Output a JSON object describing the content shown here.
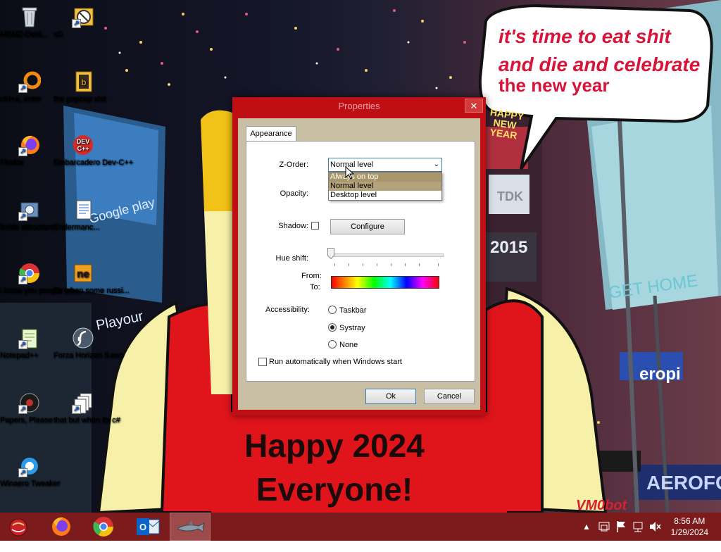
{
  "wallpaper": {
    "bubble_lines": [
      "it's time to eat shit",
      "and die and celebrate",
      "the new year"
    ],
    "poster_lines": [
      "Happy 2024",
      "Everyone!"
    ],
    "billboard_texts": [
      "Google play",
      "TDK",
      "GET HOME",
      "eropi",
      "AEROFOS",
      "VM0bot",
      "HAPPY NEW YEAR",
      "2015",
      "Playour"
    ]
  },
  "desktop_icons": [
    {
      "label": "MEMZ-Dest...",
      "icon": "recycle-bin-icon"
    },
    {
      "label": "xD",
      "icon": "blocked-image-icon"
    },
    {
      "label": "ctrl+a, enter",
      "icon": "orange-ring-icon"
    },
    {
      "label": "the popcap shit",
      "icon": "popcap-folder-icon"
    },
    {
      "label": "Firefox",
      "icon": "firefox-icon"
    },
    {
      "label": "Embarcadero Dev-C++",
      "icon": "devcpp-icon"
    },
    {
      "label": "forkie attractant",
      "icon": "settings-app-icon"
    },
    {
      "label": "Endermanc...",
      "icon": "document-icon"
    },
    {
      "label": "i know you people we...",
      "icon": "chrome-icon"
    },
    {
      "label": "for when some russi...",
      "icon": "dotnet-icon"
    },
    {
      "label": "Notepad++",
      "icon": "notepadpp-icon"
    },
    {
      "label": "Forza Horizon 5.exe",
      "icon": "flash-icon"
    },
    {
      "label": "Papers, Please",
      "icon": "papers-please-icon"
    },
    {
      "label": "that but when its c#",
      "icon": "stacked-pages-icon"
    },
    {
      "label": "Winaero Tweaker",
      "icon": "speed-sign-icon"
    }
  ],
  "dialog": {
    "title": "Properties",
    "close_glyph": "✕",
    "tab": "Appearance",
    "zorder_label": "Z-Order:",
    "zorder_selected": "Normal level",
    "zorder_options": [
      "Always on top",
      "Normal level",
      "Desktop level"
    ],
    "opacity_label": "Opacity:",
    "shadow_label": "Shadow:",
    "shadow_checked": false,
    "configure_label": "Configure",
    "hue_label": "Hue shift:",
    "hue_value": 0,
    "from_label": "From:",
    "to_label": "To:",
    "accessibility_label": "Accessibility:",
    "accessibility_options": [
      {
        "label": "Taskbar",
        "checked": false
      },
      {
        "label": "Systray",
        "checked": true
      },
      {
        "label": "None",
        "checked": false
      }
    ],
    "autorun_label": "Run automatically when Windows start",
    "autorun_checked": false,
    "ok_label": "Ok",
    "cancel_label": "Cancel"
  },
  "taskbar": {
    "apps": [
      "ornament-start-icon",
      "firefox-icon",
      "chrome-icon",
      "outlook-icon",
      "shark-app-icon"
    ],
    "active_index": 4,
    "tray": [
      "chevron-up-icon",
      "network-devices-icon",
      "flag-icon",
      "network-icon",
      "muted-speaker-icon"
    ],
    "time": "8:56 AM",
    "date": "1/29/2024"
  },
  "colors": {
    "dialog_frame": "#bf0e14",
    "taskbar": "#7b1b1b",
    "bubble_text": "#d8143a",
    "accent_selection": "#a8966a"
  }
}
